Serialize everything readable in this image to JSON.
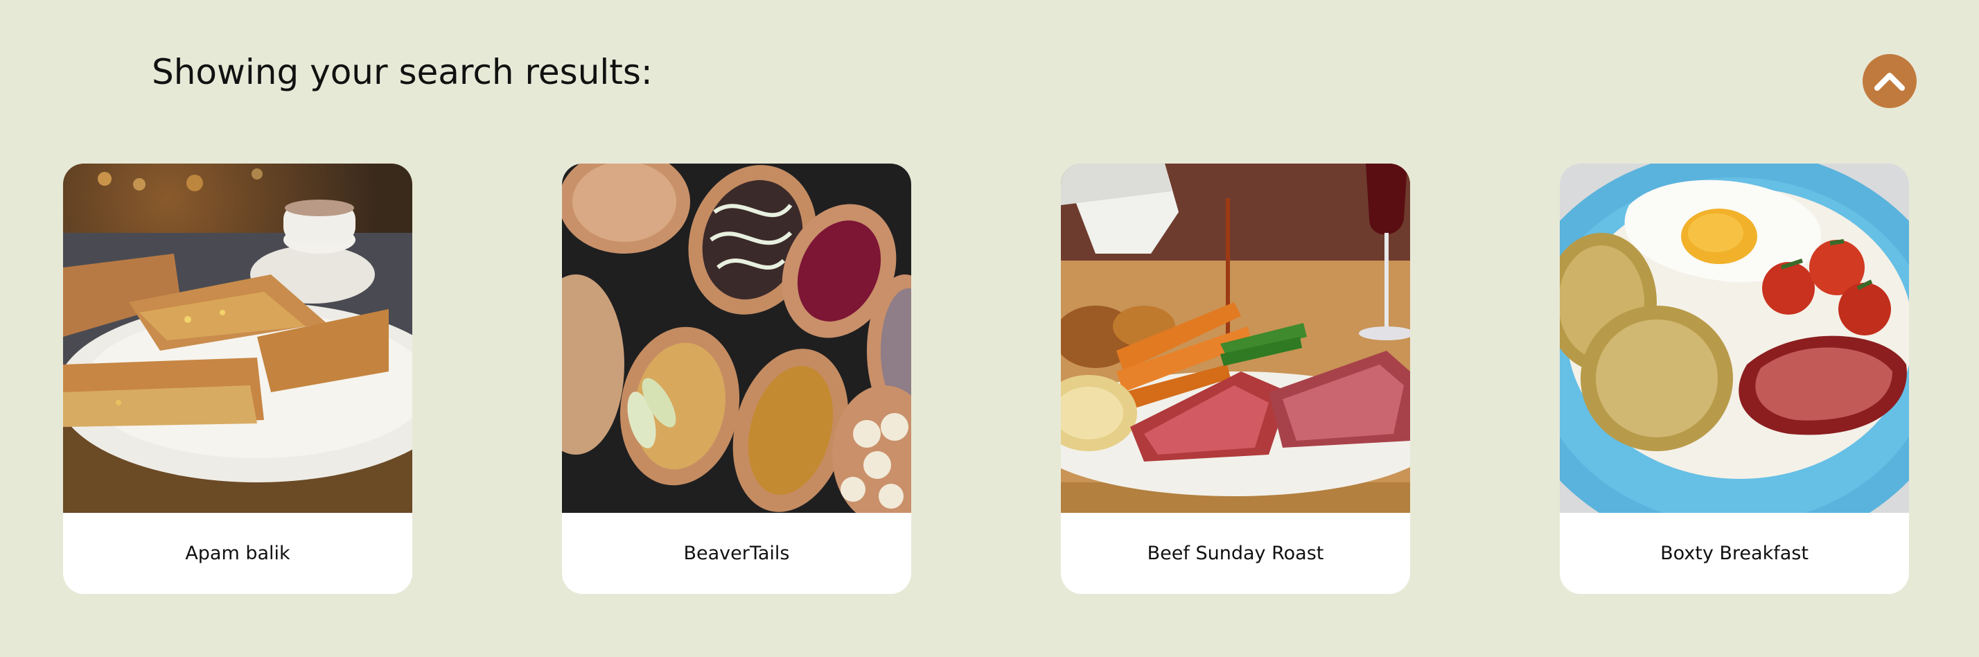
{
  "header": {
    "title": "Showing your search results:"
  },
  "scroll_top_button": {
    "icon": "chevron-up-icon",
    "color": "#c17a3d"
  },
  "results": [
    {
      "name": "Apam balik",
      "image_subject": "folded peanut pancake slices on a white plate with a teacup"
    },
    {
      "name": "BeaverTails",
      "image_subject": "oval fried pastries with assorted toppings on a dark tray"
    },
    {
      "name": "Beef Sunday Roast",
      "image_subject": "sliced roast beef with carrots, green beans and gravy being poured"
    },
    {
      "name": "Boxty Breakfast",
      "image_subject": "potato pancakes with fried egg, bacon and tomatoes on a blue plate"
    }
  ]
}
